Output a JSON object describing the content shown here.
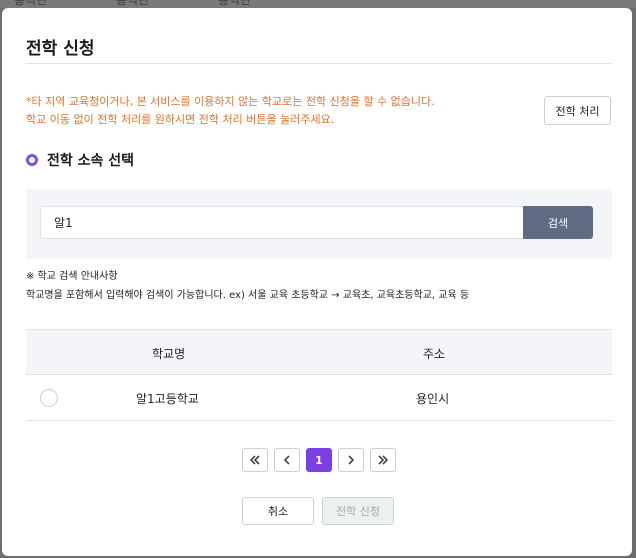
{
  "background": {
    "items": [
      "흥력관",
      "흥력관",
      "흥력관"
    ]
  },
  "modal": {
    "title": "전학 신청",
    "notice_line1": "*타 지역 교육청이거나, 본 서비스를 이용하지 않는 학교로는 전학 신청을 할 수 없습니다.",
    "notice_line2": "학교 이동 없이 전학 처리를 원하시면 전학 처리 버튼을 눌러주세요.",
    "transfer_process_label": "전학 처리",
    "section_title": "전학 소속 선택",
    "search": {
      "value": "알1",
      "placeholder": "",
      "button_label": "검색"
    },
    "guide_title": "※ 학교 검색 안내사항",
    "guide_text": "학교명을 포함해서 입력해야 검색이 가능합니다. ex) 서울 교육 초등학교 → 교육초, 교육초등학교, 교육 등",
    "table": {
      "headers": [
        "학교명",
        "주소"
      ],
      "rows": [
        {
          "name": "알1고등학교",
          "address": "용인시",
          "selected": false
        }
      ]
    },
    "pagination": {
      "current_page": "1",
      "first_icon": "double-chevron-left-icon",
      "prev_icon": "chevron-left-icon",
      "next_icon": "chevron-right-icon",
      "last_icon": "double-chevron-right-icon"
    },
    "cancel_label": "취소",
    "apply_label": "전학 신청"
  },
  "colors": {
    "accent": "#7b3fe4",
    "notice": "#e0732a",
    "search_button": "#5f6b82",
    "panel_bg": "#f4f5f9"
  }
}
